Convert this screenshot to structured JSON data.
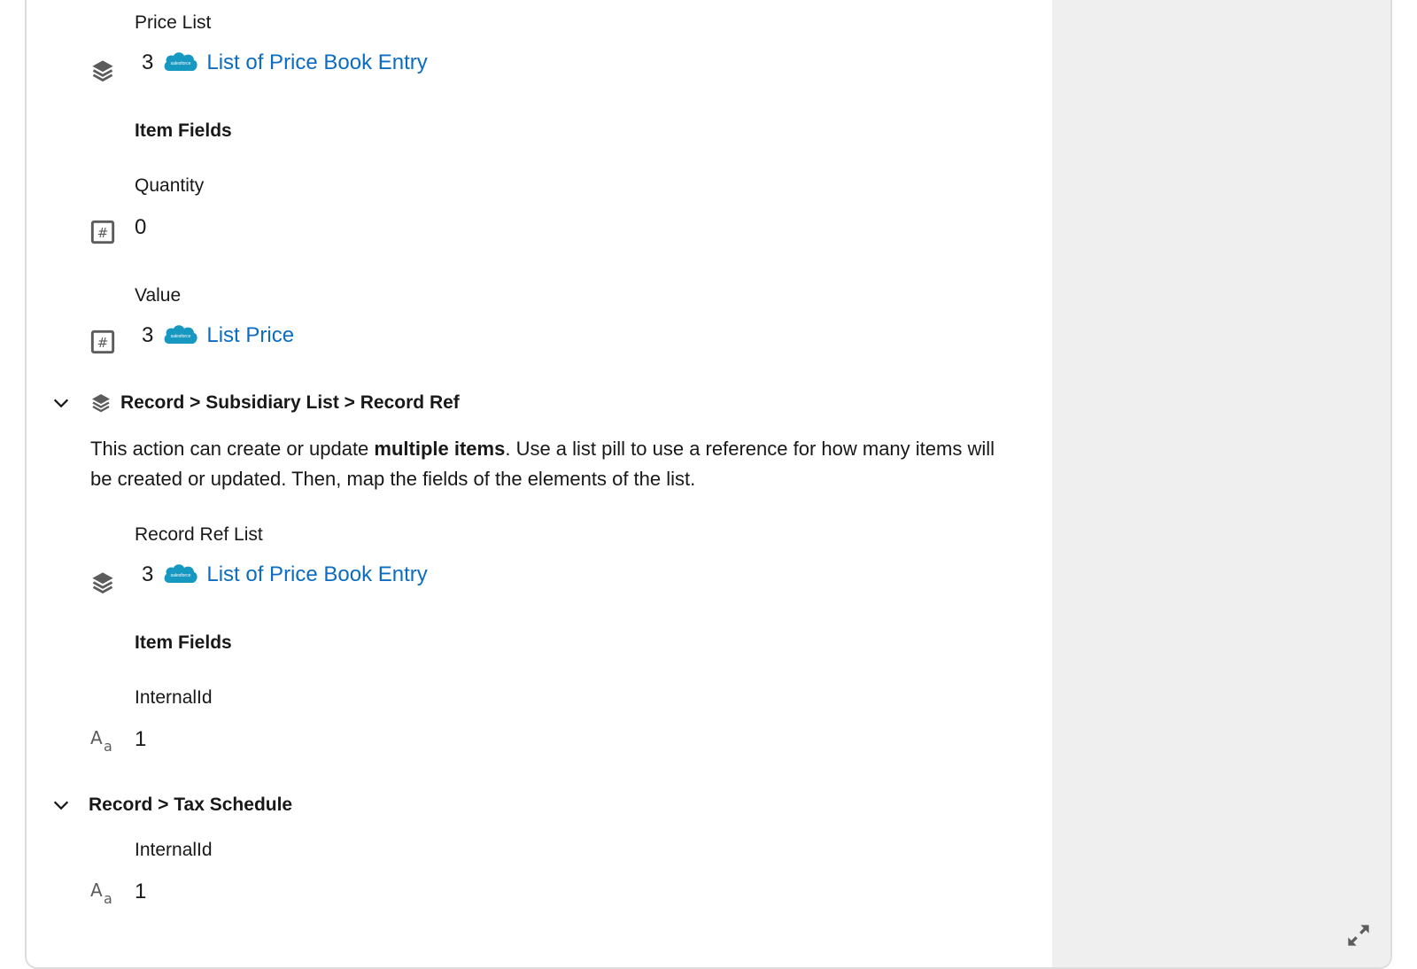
{
  "price_list": {
    "label": "Price List",
    "pill_count": "3",
    "pill_source": "salesforce",
    "pill_text": "List of Price Book Entry",
    "item_fields_heading": "Item Fields",
    "fields": [
      {
        "label": "Quantity",
        "type_icon": "number-icon",
        "value": "0"
      },
      {
        "label": "Value",
        "type_icon": "number-icon",
        "pill_count": "3",
        "pill_source": "salesforce",
        "pill_text": "List Price"
      }
    ]
  },
  "subsidiary_section": {
    "title": "Record > Subsidiary List > Record Ref",
    "icon": "layers-icon",
    "expanded": true,
    "description_pre": "This action can create or update ",
    "description_bold": "multiple items",
    "description_post": ". Use a list pill to use a reference for how many items will be created or updated. Then, map the fields of the elements of the list.",
    "list_label": "Record Ref List",
    "pill_count": "3",
    "pill_source": "salesforce",
    "pill_text": "List of Price Book Entry",
    "item_fields_heading": "Item Fields",
    "fields": [
      {
        "label": "InternalId",
        "type_icon": "text-icon",
        "value": "1"
      }
    ]
  },
  "tax_section": {
    "title": "Record > Tax Schedule",
    "expanded": true,
    "fields": [
      {
        "label": "InternalId",
        "type_icon": "text-icon",
        "value": "1"
      }
    ]
  },
  "logo_text": "salesforce",
  "colors": {
    "link": "#0b6cc2",
    "salesforce_blue": "#1798c1",
    "icon_gray": "#5c5c5c",
    "panel_gray": "#efefef"
  }
}
